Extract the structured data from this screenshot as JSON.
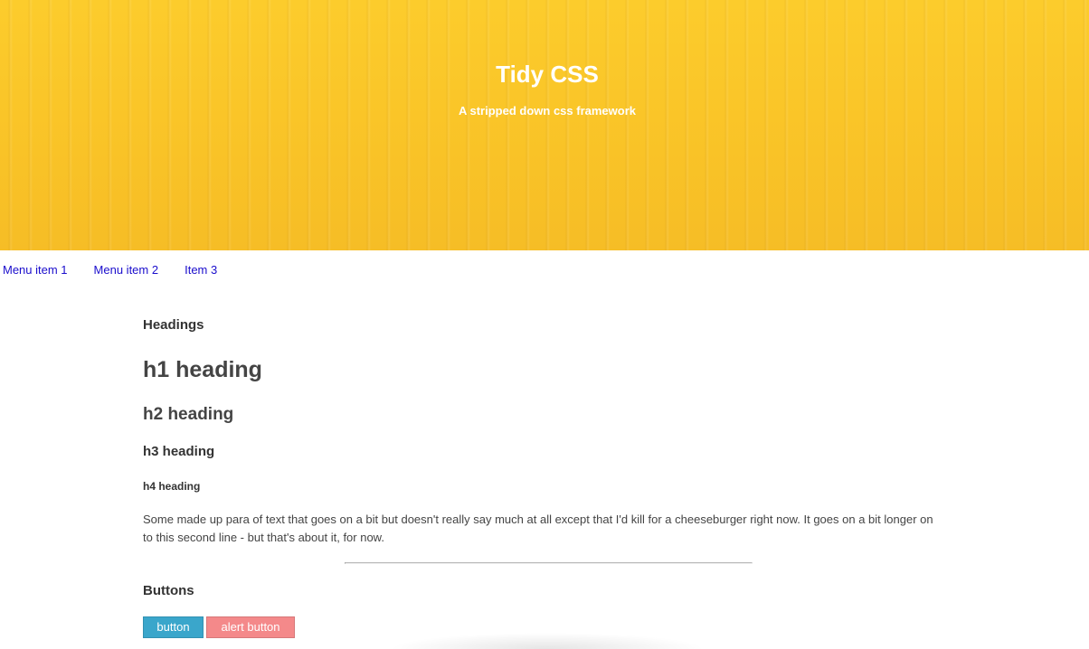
{
  "hero": {
    "title": "Tidy CSS",
    "subtitle": "A stripped down css framework",
    "background_color": "#fbc62a"
  },
  "menu": {
    "items": [
      {
        "label": "Menu item 1"
      },
      {
        "label": "Menu item 2"
      },
      {
        "label": "Item 3"
      }
    ],
    "link_color": "#1a0dcc"
  },
  "headings_section": {
    "title": "Headings",
    "h1": "h1 heading",
    "h2": "h2 heading",
    "h3": "h3 heading",
    "h4": "h4 heading",
    "paragraph": "Some made up para of text that goes on a bit but doesn't really say much at all except that I'd kill for a cheeseburger right now. It goes on a bit longer on to this second line - but that's about it, for now."
  },
  "buttons_section": {
    "title": "Buttons",
    "primary_label": "button",
    "alert_label": "alert button",
    "primary_color": "#3aa6cb",
    "alert_color": "#f4898a"
  }
}
